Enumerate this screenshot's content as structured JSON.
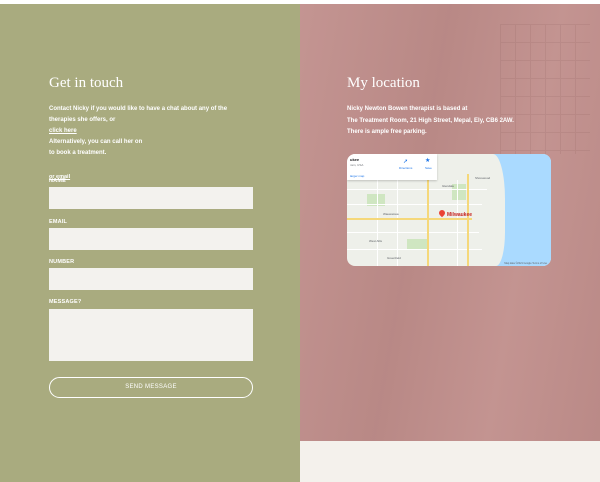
{
  "contact": {
    "heading": "Get in touch",
    "intro_line1": "Contact Nicky if you would like to have a chat about any of the",
    "intro_line2": "therapies she offers, or",
    "click_here": "click here",
    "alt_line": "Alternatively, you can call her on",
    "book_line": "to book a treatment.",
    "email_link": "or email",
    "fields": {
      "name_label": "NAME",
      "email_label": "EMAIL",
      "number_label": "NUMBER",
      "message_label": "MESSAGE?"
    },
    "send_label": "SEND MESSAGE"
  },
  "location": {
    "heading": "My location",
    "line1": "Nicky Newton Bowen therapist is based at",
    "line2": "The Treatment Room, 21 High Street, Mepal, Ely, CB6 2AW.",
    "line3": "There is ample free parking."
  },
  "map": {
    "card_title": "ukee",
    "card_sub": "nsin, USA",
    "card_link": "larger map",
    "directions_label": "Directions",
    "save_label": "Save",
    "city_label": "Milwaukee",
    "footer": "Map data ©2021 Google  Terms of Use",
    "labels": [
      "Glendale",
      "Wauwatosa",
      "West Allis",
      "Greenfield",
      "Shorewood"
    ]
  }
}
